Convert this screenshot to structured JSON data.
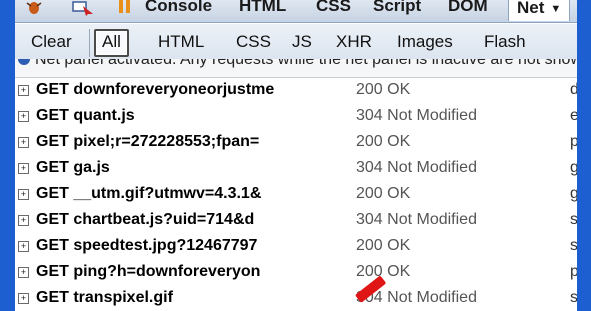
{
  "tabbar": {
    "tabs": [
      {
        "label": "Console"
      },
      {
        "label": "HTML"
      },
      {
        "label": "CSS"
      },
      {
        "label": "Script"
      },
      {
        "label": "DOM"
      },
      {
        "label": "Net",
        "active": true
      }
    ],
    "net_caret": "▼"
  },
  "toolbar": {
    "filters": [
      {
        "label": "Clear"
      },
      {
        "label": "All",
        "active": true
      },
      {
        "label": "HTML"
      },
      {
        "label": "CSS"
      },
      {
        "label": "JS"
      },
      {
        "label": "XHR"
      },
      {
        "label": "Images"
      },
      {
        "label": "Flash"
      }
    ]
  },
  "notice": {
    "text": "Net panel activated. Any requests while the net panel is inactive are not shown."
  },
  "requests": [
    {
      "method_url": "GET downforeveryoneorjustme",
      "status": "200 OK",
      "domain": "do"
    },
    {
      "method_url": "GET quant.js",
      "status": "304 Not Modified",
      "domain": "ed"
    },
    {
      "method_url": "GET pixel;r=272228553;fpan=",
      "status": "200 OK",
      "domain": "pi"
    },
    {
      "method_url": "GET ga.js",
      "status": "304 Not Modified",
      "domain": "go"
    },
    {
      "method_url": "GET __utm.gif?utmwv=4.3.1&",
      "status": "200 OK",
      "domain": "go"
    },
    {
      "method_url": "GET chartbeat.js?uid=714&d",
      "status": "304 Not Modified",
      "domain": "st"
    },
    {
      "method_url": "GET speedtest.jpg?12467797",
      "status": "200 OK",
      "domain": "st"
    },
    {
      "method_url": "GET ping?h=downforeveryon",
      "status": "200 OK",
      "domain": "pi"
    },
    {
      "method_url": "GET transpixel.gif",
      "status": "304 Not Modified",
      "domain": "st"
    }
  ],
  "colors": {
    "frame": "#1d5fd0",
    "pause_icon": "#e8901a",
    "annotation_arrow": "#e01515"
  }
}
